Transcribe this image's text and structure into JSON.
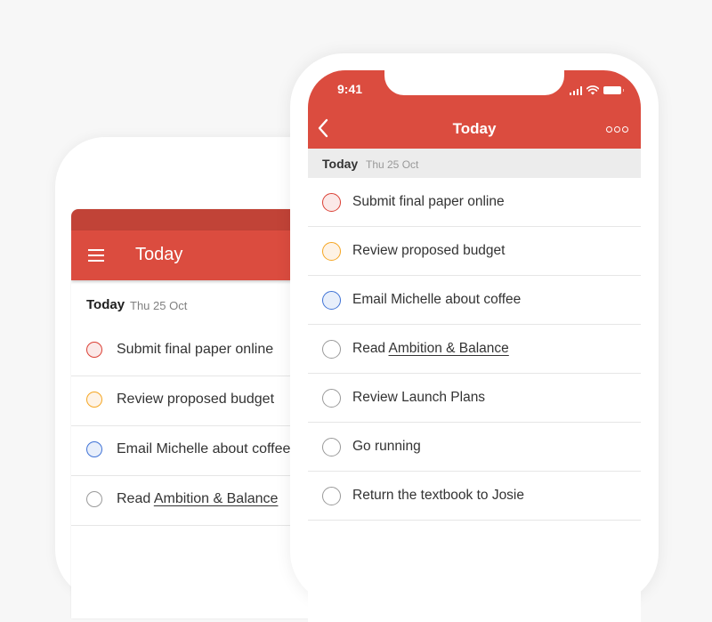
{
  "colors": {
    "brand_red": "#db4c3f",
    "status_bar_dark_red": "#c14337",
    "priority_1": "#db4035",
    "priority_2": "#fad000",
    "priority_3": "#4073d6"
  },
  "android_phone": {
    "menu_icon": "hamburger-menu-icon",
    "title": "Today",
    "section": {
      "title": "Today",
      "date": "Thu 25 Oct"
    },
    "tasks": [
      {
        "prefix": "",
        "label": "Submit final paper online",
        "link": "",
        "priority": "p1"
      },
      {
        "prefix": "",
        "label": "Review proposed budget",
        "link": "",
        "priority": "p2"
      },
      {
        "prefix": "",
        "label": "Email Michelle about coffee",
        "link": "",
        "priority": "p3"
      },
      {
        "prefix": "Read ",
        "label": "",
        "link": "Ambition & Balance",
        "priority": "p4"
      }
    ]
  },
  "ios_phone": {
    "status_bar": {
      "time": "9:41",
      "icons": [
        "signal-icon",
        "wifi-icon",
        "battery-icon"
      ]
    },
    "nav": {
      "back_icon": "chevron-left-icon",
      "title": "Today",
      "more_icon": "more-options-icon"
    },
    "section": {
      "title": "Today",
      "date": "Thu 25 Oct"
    },
    "tasks": [
      {
        "prefix": "",
        "label": "Submit final paper online",
        "link": "",
        "priority": "p1"
      },
      {
        "prefix": "",
        "label": "Review proposed budget",
        "link": "",
        "priority": "p2"
      },
      {
        "prefix": "",
        "label": "Email Michelle about coffee",
        "link": "",
        "priority": "p3"
      },
      {
        "prefix": "Read ",
        "label": "",
        "link": "Ambition & Balance",
        "priority": "p4"
      },
      {
        "prefix": "",
        "label": "Review Launch Plans",
        "link": "",
        "priority": "p4"
      },
      {
        "prefix": "",
        "label": "Go running",
        "link": "",
        "priority": "p4"
      },
      {
        "prefix": "",
        "label": "Return the textbook to Josie",
        "link": "",
        "priority": "p4"
      }
    ]
  }
}
